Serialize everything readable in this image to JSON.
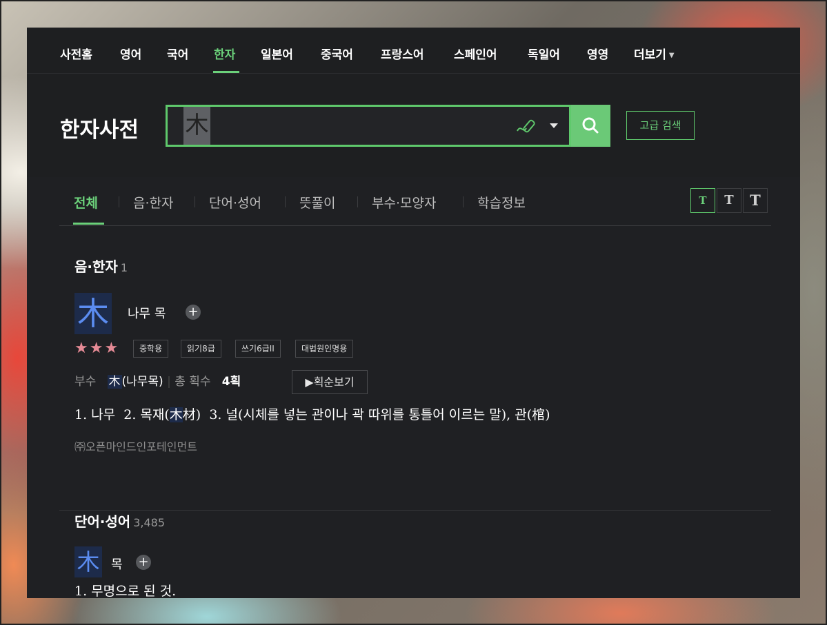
{
  "top_nav": {
    "items": [
      "사전홈",
      "영어",
      "국어",
      "한자",
      "일본어",
      "중국어",
      "프랑스어",
      "스페인어",
      "독일어",
      "영영",
      "더보기"
    ],
    "active": "한자"
  },
  "header": {
    "title": "한자사전",
    "search_query": "木",
    "advanced_search_label": "고급 검색"
  },
  "tabs": {
    "items": [
      "전체",
      "음·한자",
      "단어·성어",
      "뜻풀이",
      "부수·모양자",
      "학습정보"
    ],
    "active": "전체",
    "font_size_icons": [
      "T",
      "T",
      "T"
    ]
  },
  "section_hanja": {
    "title": "음·한자",
    "count": "1",
    "entry": {
      "character": "木",
      "reading": "나무 목",
      "stars": "★★★",
      "badges": [
        "중학용",
        "읽기8급",
        "쓰기6급II",
        "대법원인명용"
      ],
      "radical_label": "부수",
      "radical_char": "木",
      "radical_name": "(나무목)",
      "stroke_label": "총 획수",
      "stroke_count": "4획",
      "stroke_order_button": "획순보기",
      "meaning_1": "1. 나무",
      "meaning_2_prefix": "2. 목재(",
      "meaning_2_highlight": "木",
      "meaning_2_rest": "材)",
      "meaning_3": "3. 널(시체를 넣는 관이나 곽 따위를 통틀어 이르는 말), 관(棺)",
      "source": "㈜오픈마인드인포테인먼트"
    }
  },
  "section_words": {
    "title": "단어·성어",
    "count": "3,485",
    "entry": {
      "character": "木",
      "reading": "목",
      "meaning": "1. 무명으로 된 것."
    }
  },
  "colors": {
    "accent": "#6bd07a",
    "panel_bg": "#1e1f21",
    "highlight_bg": "#1d2b4a",
    "hanja_blue": "#5b8cf0",
    "star": "#e58a95"
  }
}
